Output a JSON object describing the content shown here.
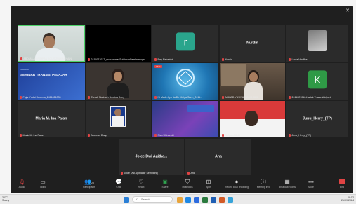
{
  "window_controls": {
    "minimize": "–",
    "maximize": "□",
    "close": "✕"
  },
  "tiles": {
    "t1": {
      "name": "ABDULLAH RIMPAN AGUS ZULKARNAIN"
    },
    "t2": {
      "name": "2411021017_muhammadSulaimanDerrimanogra"
    },
    "t3": {
      "letter": "r",
      "name": "Rey Nabatrini"
    },
    "t4": {
      "center": "Nurdin",
      "name": "Nurdin"
    },
    "t5": {
      "name": "Lenia Verdiha"
    },
    "t6": {
      "banner_small": "SEMINAR",
      "banner_title": "SEMINAR TRANSISI PELAJAR",
      "name": "Fajar Yudai Kusuma_2411021033"
    },
    "t7": {
      "name": "Eterah Nurimah Umaisa Dzey"
    },
    "t8": {
      "badge": "LIVE",
      "name": "Ni Made Ayu Ita De Melya Sanh_2411..."
    },
    "t9": {
      "name": "AHMAD YUSYAHYA KO DUJ"
    },
    "t10": {
      "letter": "K",
      "name": "2411021016-Kadek Trisna Widyanti"
    },
    "t11": {
      "center": "Maria M. Ina Palan",
      "name": "Maria M. Ina Palan"
    },
    "t12": {
      "name": "Andreas Dunp"
    },
    "t13": {
      "name": "Siva Ulfinandri"
    },
    "t14": {
      "name": "Sofyan Alfi Jil"
    },
    "t15": {
      "center": "Junu_Herry_(TP)",
      "name": "Junu_Herry_(TP)"
    },
    "t16": {
      "center": "Joice Dwi Agitha...",
      "name": "Joice Dwi Agitha Br Sembiring"
    },
    "t17": {
      "center": "Ana",
      "name": "Ana"
    }
  },
  "toolbar": {
    "audio": "Audio",
    "video": "Video",
    "participants": "Participants",
    "participants_count": "25",
    "chat": "Chat",
    "react": "React",
    "share": "Share",
    "host_tools": "Host tools",
    "apps": "Apps",
    "recording": "Record local recording",
    "meeting_info": "Meeting info",
    "breakout": "Breakout rooms",
    "more": "More",
    "end": "End"
  },
  "taskbar": {
    "weather_temp": "30°C",
    "weather_desc": "Sunny",
    "search_placeholder": "Search",
    "time": "09:52",
    "date": "21/09/2024"
  },
  "colors": {
    "bg": "#1f1f1f",
    "tile": "#2b2b2b",
    "mic_muted": "#e04444",
    "avatar_teal": "#2aa58c",
    "avatar_green": "#2f9a46",
    "share_green": "#2fa54f",
    "end_red": "#e04444"
  }
}
